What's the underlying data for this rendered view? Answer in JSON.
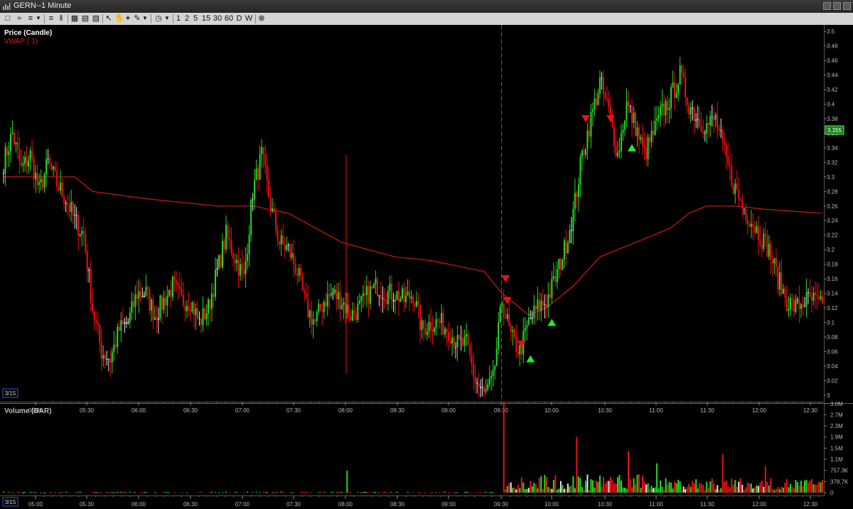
{
  "window": {
    "title": "GERN--1 Minute"
  },
  "toolbar": {
    "intervals": [
      "1",
      "2",
      "5",
      "15",
      "30",
      "60",
      "D",
      "W"
    ]
  },
  "price_pane": {
    "label_price": "Price (Candle)",
    "label_vwap": "VWAP (-1)",
    "last_price_tag": "3.355",
    "date_marker": "3/15",
    "colors": {
      "up": "#22dd22",
      "down": "#ee1111",
      "vwap": "#d01818",
      "background": "#000000",
      "buy_signal": "#22ee22",
      "sell_signal": "#ee1111"
    }
  },
  "volume_pane": {
    "label": "Volume (BAR)",
    "date_marker": "3/15"
  },
  "chart_data": [
    {
      "type": "candlestick",
      "title": "Price (Candle)",
      "series": [
        {
          "name": "Price (Candle)",
          "anchors": [
            [
              0,
              3.32
            ],
            [
              5,
              3.36
            ],
            [
              10,
              3.31
            ],
            [
              15,
              3.33
            ],
            [
              20,
              3.28
            ],
            [
              25,
              3.32
            ],
            [
              30,
              3.29
            ],
            [
              35,
              3.27
            ],
            [
              40,
              3.24
            ],
            [
              45,
              3.22
            ],
            [
              50,
              3.12
            ],
            [
              55,
              3.06
            ],
            [
              60,
              3.05
            ],
            [
              65,
              3.09
            ],
            [
              70,
              3.1
            ],
            [
              75,
              3.14
            ],
            [
              80,
              3.14
            ],
            [
              85,
              3.11
            ],
            [
              90,
              3.13
            ],
            [
              95,
              3.15
            ],
            [
              100,
              3.13
            ],
            [
              105,
              3.13
            ],
            [
              110,
              3.1
            ],
            [
              115,
              3.12
            ],
            [
              120,
              3.17
            ],
            [
              125,
              3.22
            ],
            [
              130,
              3.19
            ],
            [
              135,
              3.16
            ],
            [
              140,
              3.28
            ],
            [
              145,
              3.33
            ],
            [
              150,
              3.26
            ],
            [
              155,
              3.21
            ],
            [
              160,
              3.2
            ],
            [
              165,
              3.17
            ],
            [
              170,
              3.12
            ],
            [
              175,
              3.1
            ],
            [
              180,
              3.13
            ],
            [
              185,
              3.14
            ],
            [
              190,
              3.13
            ],
            [
              195,
              3.11
            ],
            [
              200,
              3.12
            ],
            [
              205,
              3.14
            ],
            [
              210,
              3.15
            ],
            [
              215,
              3.14
            ],
            [
              220,
              3.14
            ],
            [
              225,
              3.13
            ],
            [
              230,
              3.14
            ],
            [
              235,
              3.09
            ],
            [
              240,
              3.1
            ],
            [
              245,
              3.1
            ],
            [
              250,
              3.09
            ],
            [
              255,
              3.07
            ],
            [
              260,
              3.07
            ],
            [
              265,
              3.02
            ],
            [
              270,
              3.0
            ],
            [
              275,
              3.02
            ],
            [
              280,
              3.13
            ],
            [
              285,
              3.08
            ],
            [
              290,
              3.06
            ],
            [
              295,
              3.1
            ],
            [
              300,
              3.12
            ],
            [
              305,
              3.13
            ],
            [
              310,
              3.16
            ],
            [
              315,
              3.2
            ],
            [
              320,
              3.25
            ],
            [
              325,
              3.33
            ],
            [
              330,
              3.38
            ],
            [
              335,
              3.43
            ],
            [
              340,
              3.39
            ],
            [
              345,
              3.33
            ],
            [
              350,
              3.4
            ],
            [
              355,
              3.37
            ],
            [
              360,
              3.33
            ],
            [
              365,
              3.36
            ],
            [
              370,
              3.39
            ],
            [
              375,
              3.41
            ],
            [
              380,
              3.44
            ],
            [
              385,
              3.4
            ],
            [
              390,
              3.38
            ],
            [
              395,
              3.37
            ],
            [
              400,
              3.38
            ],
            [
              405,
              3.33
            ],
            [
              410,
              3.29
            ],
            [
              415,
              3.26
            ],
            [
              420,
              3.24
            ],
            [
              425,
              3.22
            ],
            [
              430,
              3.2
            ],
            [
              435,
              3.16
            ],
            [
              440,
              3.13
            ],
            [
              445,
              3.12
            ],
            [
              450,
              3.13
            ],
            [
              455,
              3.13
            ],
            [
              460,
              3.12
            ]
          ]
        },
        {
          "name": "VWAP (-1)",
          "anchors": [
            [
              0,
              3.3
            ],
            [
              40,
              3.3
            ],
            [
              50,
              3.28
            ],
            [
              80,
              3.27
            ],
            [
              120,
              3.26
            ],
            [
              140,
              3.26
            ],
            [
              160,
              3.25
            ],
            [
              175,
              3.23
            ],
            [
              190,
              3.21
            ],
            [
              220,
              3.19
            ],
            [
              240,
              3.185
            ],
            [
              270,
              3.17
            ],
            [
              280,
              3.14
            ],
            [
              295,
              3.11
            ],
            [
              305,
              3.12
            ],
            [
              320,
              3.15
            ],
            [
              335,
              3.19
            ],
            [
              355,
              3.21
            ],
            [
              365,
              3.22
            ],
            [
              375,
              3.23
            ],
            [
              385,
              3.25
            ],
            [
              395,
              3.26
            ],
            [
              410,
              3.26
            ],
            [
              430,
              3.255
            ],
            [
              460,
              3.25
            ]
          ]
        }
      ],
      "x_ticks": [
        "05:00",
        "05:30",
        "06:00",
        "06:30",
        "07:00",
        "07:30",
        "08:00",
        "08:30",
        "09:00",
        "09:30",
        "10:00",
        "10:30",
        "11:00",
        "11:30",
        "12:00",
        "12:30"
      ],
      "y_ticks": [
        "3",
        "3.02",
        "3.04",
        "3.06",
        "3.08",
        "3.1",
        "3.12",
        "3.14",
        "3.16",
        "3.18",
        "3.2",
        "3.22",
        "3.24",
        "3.26",
        "3.28",
        "3.3",
        "3.32",
        "3.34",
        "3.36",
        "3.38",
        "3.4",
        "3.42",
        "3.44",
        "3.46",
        "3.48",
        "3.5"
      ],
      "ylim": [
        2.995,
        3.505
      ],
      "signals": [
        {
          "type": "sell",
          "bar": 282,
          "price": 3.16
        },
        {
          "type": "sell",
          "bar": 283,
          "price": 3.13
        },
        {
          "type": "sell",
          "bar": 291,
          "price": 3.07
        },
        {
          "type": "buy",
          "bar": 296,
          "price": 3.05
        },
        {
          "type": "buy",
          "bar": 308,
          "price": 3.1
        },
        {
          "type": "sell",
          "bar": 327,
          "price": 3.38
        },
        {
          "type": "sell",
          "bar": 341,
          "price": 3.38
        },
        {
          "type": "buy",
          "bar": 353,
          "price": 3.34
        }
      ]
    },
    {
      "type": "bar",
      "title": "Volume (BAR)",
      "y_ticks": [
        "0",
        "378.7K",
        "757.3K",
        "1.1M",
        "1.5M",
        "1.9M",
        "2.3M",
        "2.7M",
        "3.0M"
      ],
      "spikes": [
        [
          193,
          0.75
        ],
        [
          281,
          3.1
        ],
        [
          322,
          1.9
        ],
        [
          351,
          1.4
        ],
        [
          367,
          1.0
        ],
        [
          404,
          1.3
        ],
        [
          428,
          0.9
        ],
        [
          459,
          0.35
        ]
      ]
    }
  ]
}
